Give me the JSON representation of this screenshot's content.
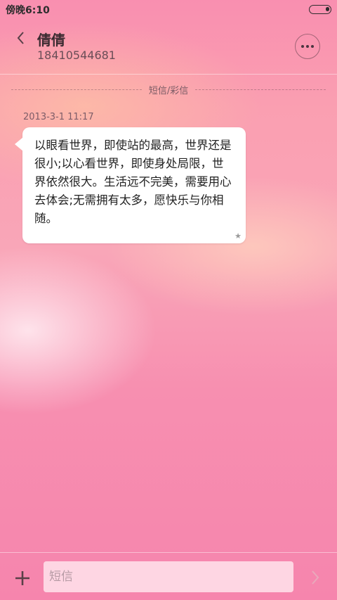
{
  "status_bar": {
    "time": "傍晚6:10",
    "battery_icon": "battery-icon"
  },
  "header": {
    "back_icon": "chevron-left-icon",
    "contact_name": "倩倩",
    "contact_number": "18410544681",
    "more_icon": "more-horizontal-icon"
  },
  "divider": {
    "label": "短信/彩信"
  },
  "messages": [
    {
      "timestamp": "2013-3-1 11:17",
      "text": "以眼看世界，即使站的最高，世界还是很小;以心看世界，即使身处局限，世界依然很大。生活远不完美，需要用心去体会;无需拥有太多，愿快乐与你相随。",
      "starred_icon": "star-icon"
    }
  ],
  "input_bar": {
    "add_icon": "plus-icon",
    "placeholder": "短信",
    "send_icon": "chevron-right-icon"
  },
  "colors": {
    "background_top": "#f98fb0",
    "background_bottom": "#f685ad",
    "bubble": "#ffffff",
    "text_dark": "#222222"
  }
}
